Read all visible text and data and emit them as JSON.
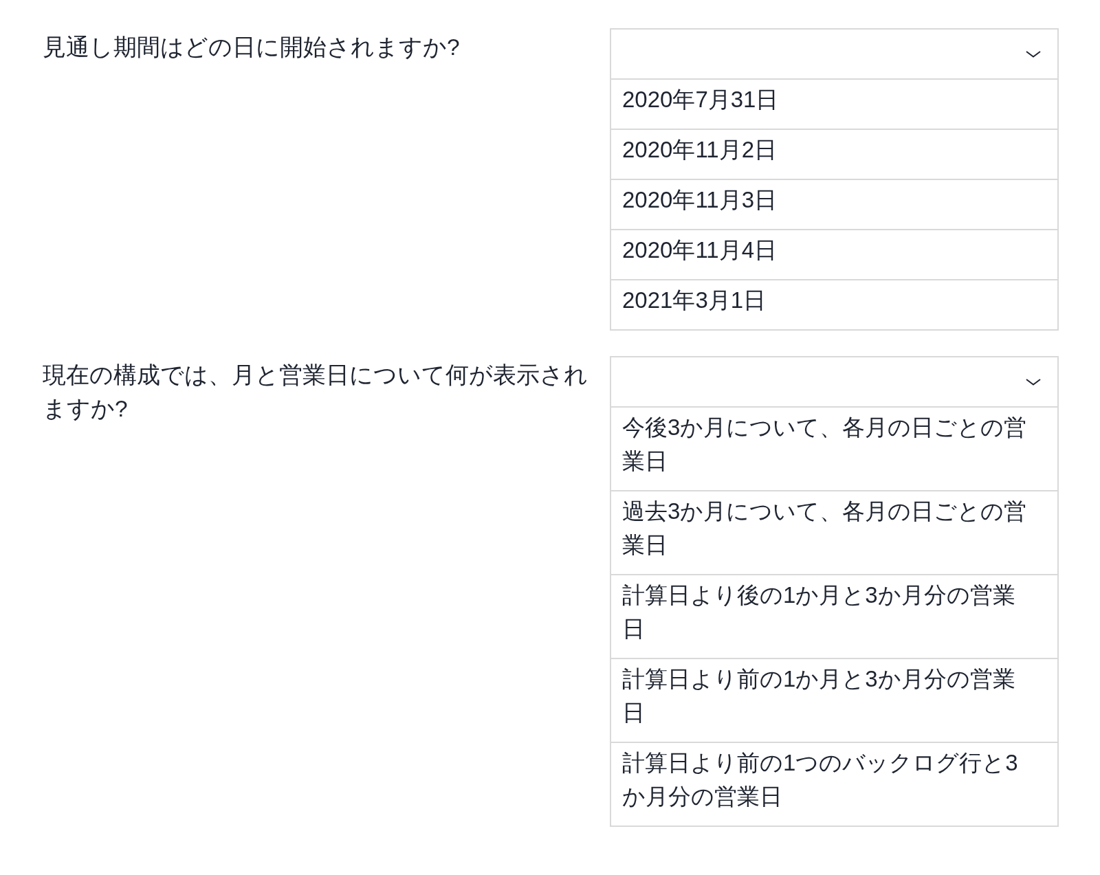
{
  "questions": [
    {
      "prompt": "見通し期間はどの日に開始されますか?",
      "options": [
        "2020年7月31日",
        "2020年11月2日",
        "2020年11月3日",
        "2020年11月4日",
        "2021年3月1日"
      ]
    },
    {
      "prompt": "現在の構成では、月と営業日について何が表示されますか?",
      "options": [
        "今後3か月について、各月の日ごとの営業日",
        "過去3か月について、各月の日ごとの営業日",
        "計算日より後の1か月と3か月分の営業日",
        "計算日より前の1か月と3か月分の営業日",
        "計算日より前の1つのバックログ行と3か月分の営業日"
      ]
    }
  ]
}
